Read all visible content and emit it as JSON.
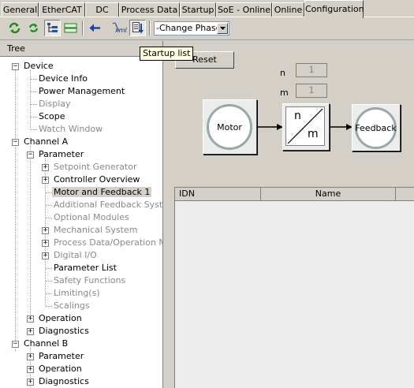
{
  "tabs": [
    "General",
    "EtherCAT",
    "DC",
    "Process Data",
    "Startup",
    "SoE - Online",
    "Online",
    "Configuration"
  ],
  "toolbar": {
    "phase_select": "-Change Phase-",
    "tooltip": "Startup list",
    "xml_label": "xml"
  },
  "tree": {
    "header": "Tree",
    "nodes": {
      "device": "Device",
      "device_info": "Device Info",
      "power_management": "Power Management",
      "display": "Display",
      "scope": "Scope",
      "watch_window": "Watch Window",
      "channel_a": "Channel A",
      "parameter": "Parameter",
      "setpoint_generator": "Setpoint Generator",
      "controller_overview": "Controller Overview",
      "motor_and_feedback": "Motor and Feedback 1",
      "additional_feedback": "Additional Feedback System",
      "optional_modules": "Optional Modules",
      "mechanical_system": "Mechanical System",
      "process_data": "Process Data/Operation Mode",
      "digital_io": "Digital I/O",
      "parameter_list": "Parameter List",
      "safety_functions": "Safety Functions",
      "limiting": "Limiting(s)",
      "scalings": "Scalings",
      "operation_a": "Operation",
      "diagnostics_a": "Diagnostics",
      "channel_b": "Channel B",
      "parameter_b": "Parameter",
      "operation_b": "Operation",
      "diagnostics_b": "Diagnostics"
    }
  },
  "config": {
    "reset_label": "Reset",
    "n_label": "n",
    "n_value": "1",
    "m_label": "m",
    "m_value": "1",
    "motor_label": "Motor",
    "gear_n": "n",
    "gear_m": "m",
    "feedback_label": "Feedback"
  },
  "grid": {
    "columns": [
      "IDN",
      "Name"
    ]
  }
}
